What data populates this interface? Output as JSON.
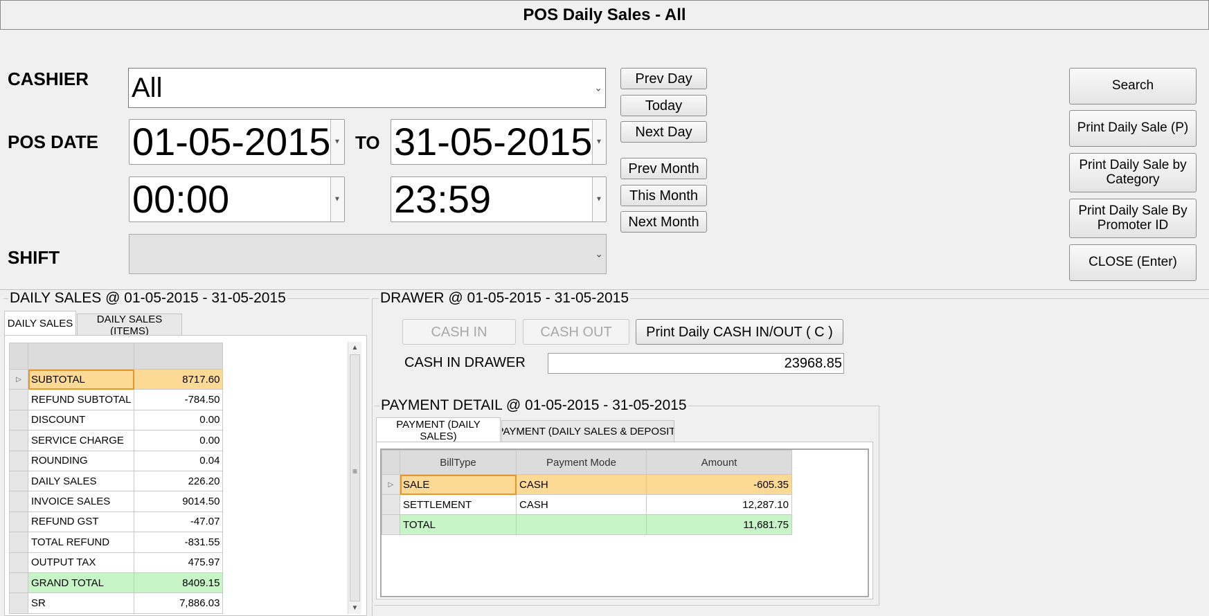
{
  "window": {
    "title": "POS Daily Sales - All"
  },
  "filters": {
    "cashier_label": "CASHIER",
    "cashier_value": "All",
    "pos_date_label": "POS DATE",
    "date_from": "01-05-2015",
    "to_label": "TO",
    "date_to": "31-05-2015",
    "time_from": "00:00",
    "time_to": "23:59",
    "shift_label": "SHIFT",
    "shift_value": ""
  },
  "nav_buttons": {
    "prev_day": "Prev Day",
    "today": "Today",
    "next_day": "Next Day",
    "prev_month": "Prev Month",
    "this_month": "This Month",
    "next_month": "Next Month"
  },
  "actions": {
    "search": "Search",
    "print_daily_sale": "Print Daily Sale (P)",
    "print_by_category": "Print Daily Sale by Category",
    "print_by_promoter": "Print Daily Sale By Promoter ID",
    "close": "CLOSE (Enter)"
  },
  "daily_sales": {
    "title": "DAILY SALES @ 01-05-2015 - 31-05-2015",
    "tabs": [
      "DAILY SALES",
      "DAILY SALES (ITEMS)"
    ],
    "rows": [
      {
        "label": "SUBTOTAL",
        "value": "8717.60"
      },
      {
        "label": "REFUND SUBTOTAL",
        "value": "-784.50"
      },
      {
        "label": "DISCOUNT",
        "value": "0.00"
      },
      {
        "label": "SERVICE CHARGE",
        "value": "0.00"
      },
      {
        "label": "ROUNDING",
        "value": "0.04"
      },
      {
        "label": "DAILY SALES",
        "value": "226.20"
      },
      {
        "label": "INVOICE SALES",
        "value": "9014.50"
      },
      {
        "label": "REFUND GST",
        "value": "-47.07"
      },
      {
        "label": "TOTAL REFUND",
        "value": "-831.55"
      },
      {
        "label": "OUTPUT TAX",
        "value": "475.97"
      },
      {
        "label": "GRAND TOTAL",
        "value": "8409.15"
      },
      {
        "label": "SR",
        "value": "7,886.03"
      }
    ]
  },
  "drawer": {
    "title": "DRAWER @ 01-05-2015 - 31-05-2015",
    "cash_in": "CASH IN",
    "cash_out": "CASH OUT",
    "print_cash": "Print Daily CASH IN/OUT ( C )",
    "cash_in_drawer_label": "CASH IN DRAWER",
    "cash_in_drawer_value": "23968.85"
  },
  "payment_detail": {
    "title": "PAYMENT DETAIL @ 01-05-2015 - 31-05-2015",
    "tabs": [
      "PAYMENT (DAILY SALES)",
      "PAYMENT (DAILY SALES & DEPOSIT)"
    ],
    "columns": [
      "BillType",
      "Payment Mode",
      "Amount"
    ],
    "rows": [
      {
        "bill_type": "SALE",
        "mode": "CASH",
        "amount": "-605.35"
      },
      {
        "bill_type": "SETTLEMENT",
        "mode": "CASH",
        "amount": "12,287.10"
      },
      {
        "bill_type": "TOTAL",
        "mode": "",
        "amount": "11,681.75"
      }
    ]
  },
  "colors": {
    "selected_row": "#fdd996",
    "selected_border": "#e8952e",
    "total_row": "#c8f5c8"
  }
}
